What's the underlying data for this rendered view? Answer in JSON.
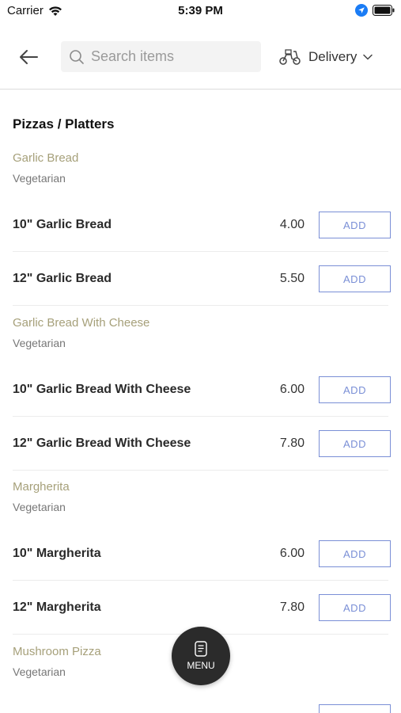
{
  "status_bar": {
    "carrier": "Carrier",
    "time": "5:39 PM"
  },
  "header": {
    "search_placeholder": "Search items",
    "delivery_label": "Delivery"
  },
  "section": {
    "title": "Pizzas / Platters"
  },
  "groups": [
    {
      "name": "Garlic Bread",
      "tag": "Vegetarian",
      "items": [
        {
          "name": "10\" Garlic Bread",
          "price": "4.00",
          "button": "ADD"
        },
        {
          "name": "12\" Garlic Bread",
          "price": "5.50",
          "button": "ADD"
        }
      ]
    },
    {
      "name": "Garlic Bread With Cheese",
      "tag": "Vegetarian",
      "items": [
        {
          "name": "10\" Garlic Bread With Cheese",
          "price": "6.00",
          "button": "ADD"
        },
        {
          "name": "12\" Garlic Bread With Cheese",
          "price": "7.80",
          "button": "ADD"
        }
      ]
    },
    {
      "name": "Margherita",
      "tag": "Vegetarian",
      "items": [
        {
          "name": "10\" Margherita",
          "price": "6.00",
          "button": "ADD"
        },
        {
          "name": "12\" Margherita",
          "price": "7.80",
          "button": "ADD"
        }
      ]
    },
    {
      "name": "Mushroom Pizza",
      "tag": "Vegetarian",
      "items": []
    }
  ],
  "fab": {
    "label": "MENU"
  },
  "colors": {
    "accent_blue": "#7a8fd6",
    "group_name": "#a6a07a",
    "fab_bg": "#2b2b2b"
  }
}
